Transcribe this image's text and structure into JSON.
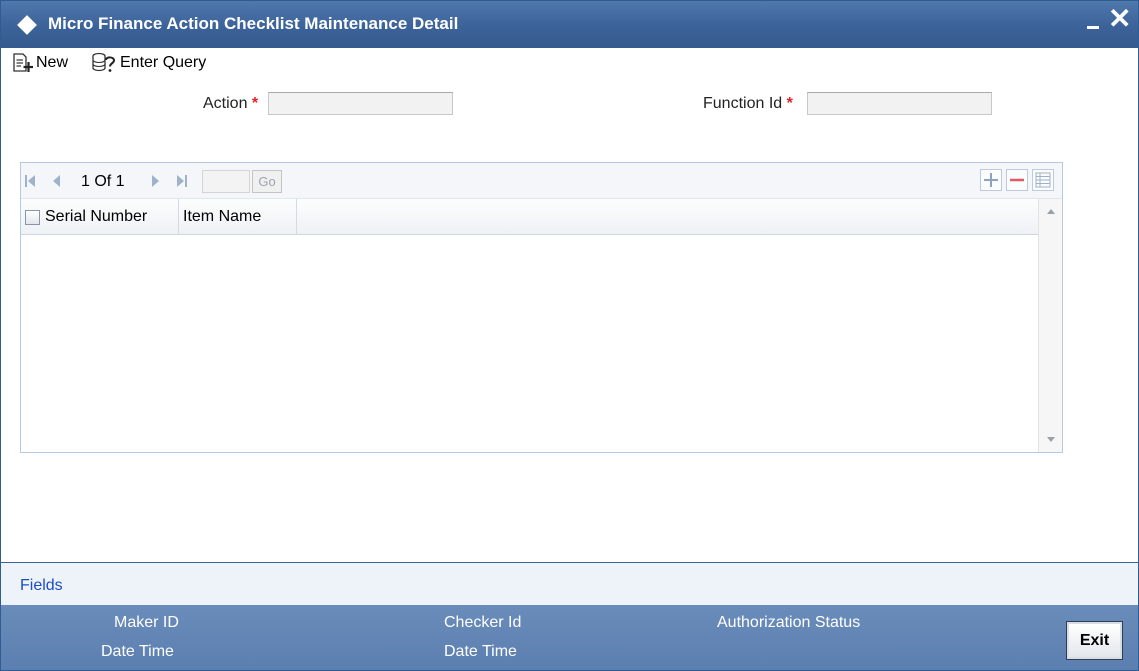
{
  "window": {
    "title": "Micro Finance Action Checklist Maintenance Detail",
    "minimize_label": "",
    "close_label": "✕"
  },
  "toolbar": {
    "new_label": "New",
    "enter_query_label": "Enter Query"
  },
  "form": {
    "action_label": "Action",
    "action_value": "",
    "function_id_label": "Function Id",
    "function_id_value": "",
    "required_marker": "*"
  },
  "grid": {
    "pager_text": "1 Of 1",
    "page_input_value": "",
    "go_label": "Go",
    "columns": [
      "Serial Number",
      "Item Name"
    ],
    "rows": []
  },
  "fields_bar": {
    "link_label": "Fields"
  },
  "footer": {
    "maker_id_label": "Maker ID",
    "maker_date_time_label": "Date Time",
    "checker_id_label": "Checker Id",
    "checker_date_time_label": "Date Time",
    "authorization_status_label": "Authorization Status",
    "exit_label": "Exit"
  },
  "colors": {
    "title_bar": "#3c6399",
    "footer": "#5f82b2",
    "required": "#e0202a",
    "link": "#1a4cc4"
  }
}
